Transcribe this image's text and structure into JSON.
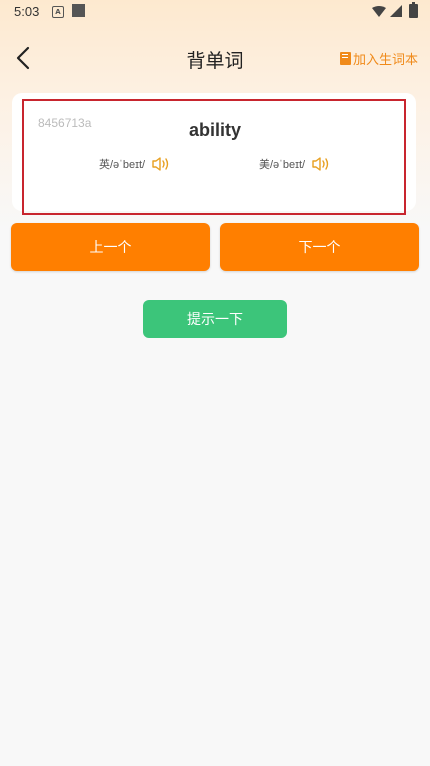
{
  "status_bar": {
    "time": "5:03",
    "notification_letter": "A"
  },
  "header": {
    "title": "背单词",
    "add_vocab_label": "加入生词本"
  },
  "word": {
    "id": "8456713a",
    "text": "ability",
    "uk_phonetic": "英/əˈbeɪt/",
    "us_phonetic": "美/əˈbeɪt/"
  },
  "buttons": {
    "prev": "上一个",
    "next": "下一个",
    "hint": "提示一下"
  },
  "colors": {
    "accent": "#ff7f00",
    "hint": "#3cc57a",
    "highlight": "#c8252e"
  }
}
